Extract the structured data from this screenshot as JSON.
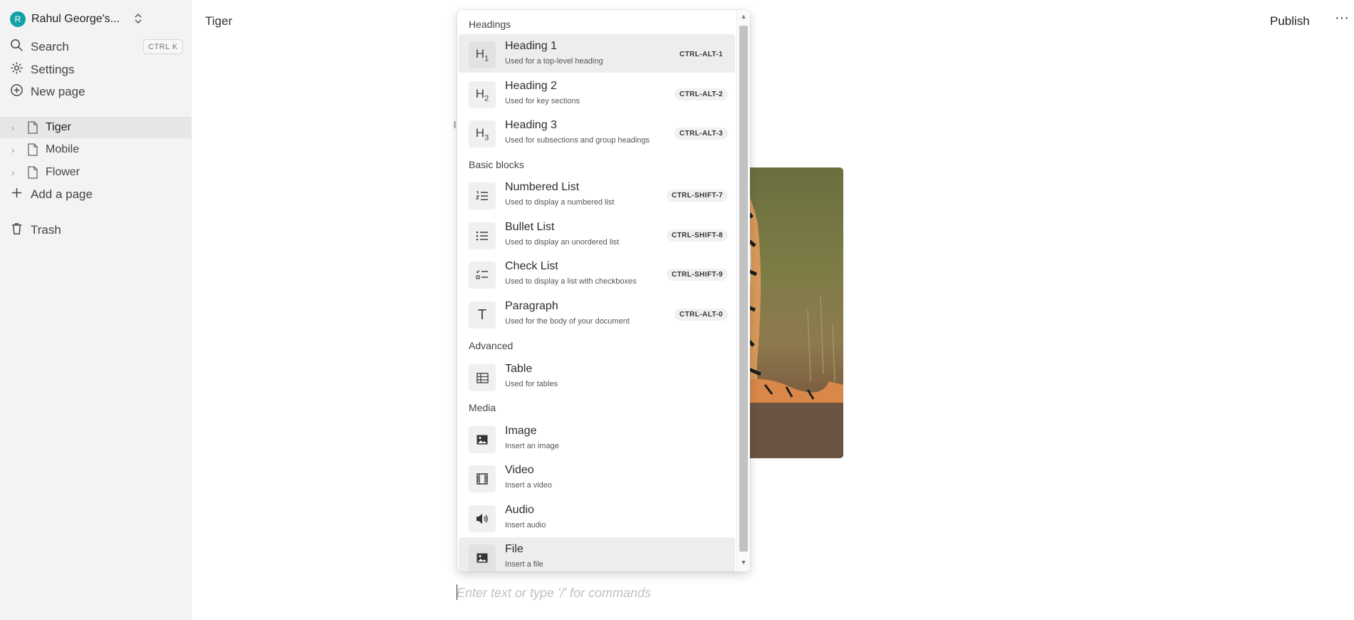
{
  "sidebar": {
    "workspace": {
      "initial": "R",
      "name": "Rahul George's...",
      "switch_icon": "chevron-up-down-icon",
      "avatar_color": "#13a0a6"
    },
    "search_label": "Search",
    "search_shortcut": "CTRL K",
    "settings_label": "Settings",
    "new_page_label": "New page",
    "pages": [
      {
        "label": "Tiger",
        "active": true
      },
      {
        "label": "Mobile",
        "active": false
      },
      {
        "label": "Flower",
        "active": false
      }
    ],
    "add_page_label": "Add a page",
    "trash_label": "Trash"
  },
  "header": {
    "title": "Tiger",
    "publish_label": "Publish",
    "more_label": "···"
  },
  "editor": {
    "placeholder": "Enter text or type '/' for commands"
  },
  "slash_menu": {
    "sections": {
      "headings": "Headings",
      "basic": "Basic blocks",
      "advanced": "Advanced",
      "media": "Media"
    },
    "items": [
      {
        "icon": "heading-1-icon",
        "glyph": "H1",
        "title": "Heading 1",
        "desc": "Used for a top-level heading",
        "shortcut": "CTRL-ALT-1"
      },
      {
        "icon": "heading-2-icon",
        "glyph": "H2",
        "title": "Heading 2",
        "desc": "Used for key sections",
        "shortcut": "CTRL-ALT-2"
      },
      {
        "icon": "heading-3-icon",
        "glyph": "H3",
        "title": "Heading 3",
        "desc": "Used for subsections and group headings",
        "shortcut": "CTRL-ALT-3"
      },
      {
        "icon": "numbered-list-icon",
        "title": "Numbered List",
        "desc": "Used to display a numbered list",
        "shortcut": "CTRL-SHIFT-7"
      },
      {
        "icon": "bullet-list-icon",
        "title": "Bullet List",
        "desc": "Used to display an unordered list",
        "shortcut": "CTRL-SHIFT-8"
      },
      {
        "icon": "check-list-icon",
        "title": "Check List",
        "desc": "Used to display a list with checkboxes",
        "shortcut": "CTRL-SHIFT-9"
      },
      {
        "icon": "paragraph-icon",
        "glyph": "T",
        "title": "Paragraph",
        "desc": "Used for the body of your document",
        "shortcut": "CTRL-ALT-0"
      },
      {
        "icon": "table-icon",
        "title": "Table",
        "desc": "Used for tables",
        "shortcut": ""
      },
      {
        "icon": "image-icon",
        "title": "Image",
        "desc": "Insert an image",
        "shortcut": ""
      },
      {
        "icon": "video-icon",
        "title": "Video",
        "desc": "Insert a video",
        "shortcut": ""
      },
      {
        "icon": "audio-icon",
        "title": "Audio",
        "desc": "Insert audio",
        "shortcut": ""
      },
      {
        "icon": "file-icon",
        "title": "File",
        "desc": "Insert a file",
        "shortcut": ""
      }
    ]
  }
}
